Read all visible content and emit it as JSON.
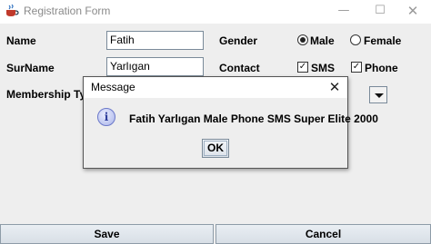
{
  "window": {
    "title": "Registration Form",
    "minimize_glyph": "—",
    "maximize_glyph": "☐",
    "close_glyph": "✕"
  },
  "form": {
    "name_label": "Name",
    "name_value": "Fatih",
    "surname_label": "SurName",
    "surname_value": "Yarlıgan",
    "membership_label": "Membership Type",
    "gender_label": "Gender",
    "gender_options": [
      {
        "label": "Male",
        "selected": true
      },
      {
        "label": "Female",
        "selected": false
      }
    ],
    "contact_label": "Contact",
    "contact_options": [
      {
        "label": "SMS",
        "checked": true
      },
      {
        "label": "Phone",
        "checked": true
      }
    ],
    "save_label": "Save",
    "cancel_label": "Cancel"
  },
  "dialog": {
    "title": "Message",
    "message": "Fatih Yarlıgan Male Phone SMS Super Elite 2000",
    "ok_label": "OK",
    "close_glyph": "✕",
    "icon_glyph": "i"
  },
  "icons": {
    "app": "java-cup-icon",
    "info": "information-icon"
  }
}
